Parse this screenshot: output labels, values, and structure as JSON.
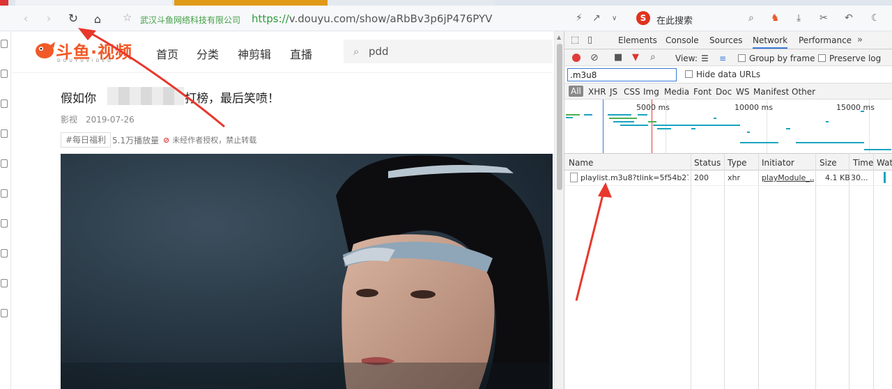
{
  "browser": {
    "url_org": "武汉斗鱼网络科技有限公司",
    "url_scheme": "https://",
    "url_rest": "v.douyu.com/show/aRbBv3p6jP476PYV",
    "search_hint": "在此搜索",
    "search_engine_letter": "S"
  },
  "site": {
    "logo_text": "斗鱼·视频",
    "logo_sub": "DOUYUVIDEO",
    "nav": [
      "首页",
      "分类",
      "神剪辑",
      "直播"
    ],
    "search_value": "pdd"
  },
  "video": {
    "title_pre": "假如你",
    "title_post": "轮打榜，最后笑喷！",
    "category": "影视",
    "date": "2019-07-26",
    "tag": "#每日福利",
    "plays": "5.1万播放量",
    "warning": "未经作者授权，禁止转载"
  },
  "devtools": {
    "tabs": [
      "Elements",
      "Console",
      "Sources",
      "Network",
      "Performance"
    ],
    "active_tab": "Network",
    "view_label": "View:",
    "group_by_frame": "Group by frame",
    "preserve_log": "Preserve log",
    "filter_value": ".m3u8",
    "hide_data_urls": "Hide data URLs",
    "filter_types": [
      "All",
      "XHR",
      "JS",
      "CSS",
      "Img",
      "Media",
      "Font",
      "Doc",
      "WS",
      "Manifest",
      "Other"
    ],
    "timeline_ticks": [
      "5000 ms",
      "10000 ms",
      "15000 ms"
    ],
    "columns": [
      "Name",
      "Status",
      "Type",
      "Initiator",
      "Size",
      "Time",
      "Wate"
    ],
    "rows": [
      {
        "name": "playlist.m3u8?tlink=5f54b27...",
        "status": "200",
        "type": "xhr",
        "initiator": "playModule_...",
        "size": "4.1 KB",
        "time": "30..."
      }
    ]
  },
  "colors": {
    "accent_orange": "#f05a28",
    "https_green": "#2e9c3b",
    "record_red": "#e23a3a",
    "selected_blue": "#3879d9",
    "annotation_red": "#e8372c"
  }
}
